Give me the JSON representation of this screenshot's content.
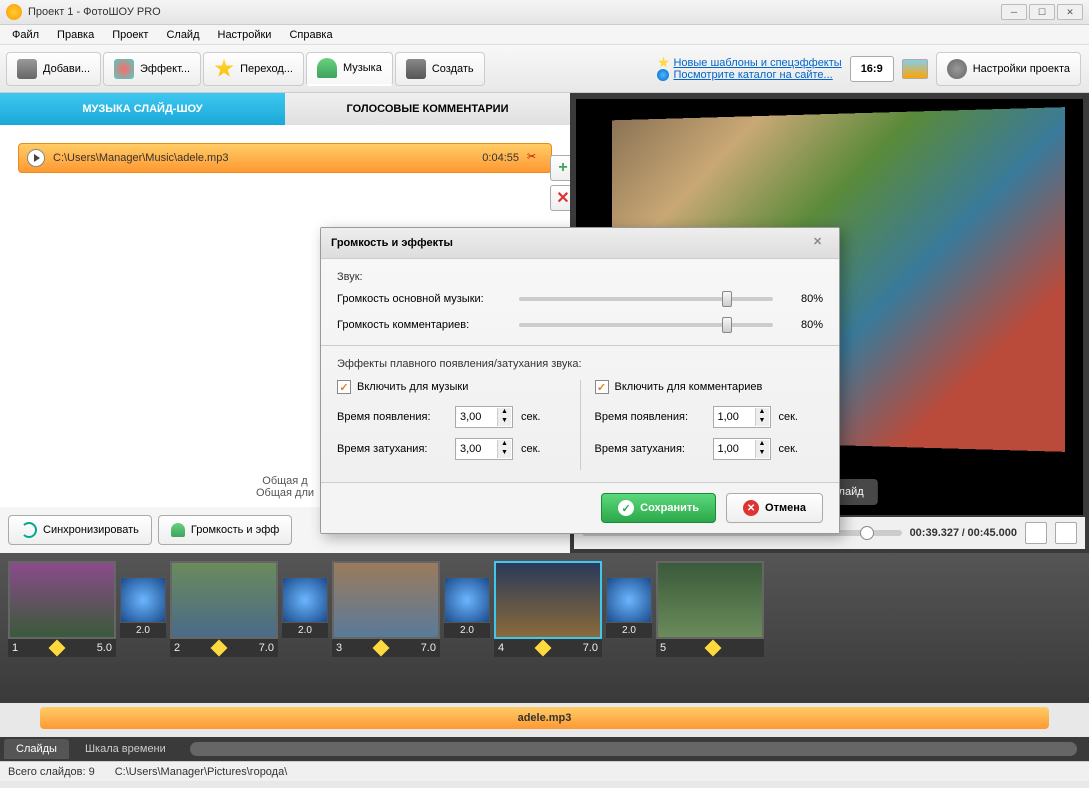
{
  "window": {
    "title": "Проект 1 - ФотоШОУ PRO"
  },
  "menu": {
    "file": "Файл",
    "edit": "Правка",
    "project": "Проект",
    "slide": "Слайд",
    "settings": "Настройки",
    "help": "Справка"
  },
  "toolbar": {
    "add": "Добави...",
    "effects": "Эффект...",
    "transitions": "Переход...",
    "music": "Музыка",
    "create": "Создать",
    "promo1": "Новые шаблоны и спецэффекты",
    "promo2": "Посмотрите каталог на сайте...",
    "aspect": "16:9",
    "project_settings": "Настройки проекта"
  },
  "tabs": {
    "music": "МУЗЫКА СЛАЙД-ШОУ",
    "voice": "ГОЛОСОВЫЕ КОММЕНТАРИИ"
  },
  "music": {
    "path": "C:\\Users\\Manager\\Music\\adele.mp3",
    "duration": "0:04:55"
  },
  "summary": {
    "line1": "Общая д",
    "line2": "Общая дли"
  },
  "buttons": {
    "sync": "Синхронизировать",
    "volume": "Громкость и эфф"
  },
  "preview": {
    "play_btn": "ать слайд",
    "time_current": "00:39.327",
    "time_total": "00:45.000"
  },
  "dialog": {
    "title": "Громкость и эффекты",
    "sound_label": "Звук:",
    "vol_music_label": "Громкость основной музыки:",
    "vol_music_val": "80%",
    "vol_comment_label": "Громкость комментариев:",
    "vol_comment_val": "80%",
    "fade_label": "Эффекты плавного появления/затухания звука:",
    "enable_music": "Включить для музыки",
    "enable_comments": "Включить для комментариев",
    "fadein_label": "Время появления:",
    "fadeout_label": "Время затухания:",
    "music_fadein": "3,00",
    "music_fadeout": "3,00",
    "comment_fadein": "1,00",
    "comment_fadeout": "1,00",
    "sec": "сек.",
    "save": "Сохранить",
    "cancel": "Отмена"
  },
  "timeline": {
    "slides": [
      {
        "num": "1",
        "dur": "5.0"
      },
      {
        "num": "2",
        "dur": "7.0"
      },
      {
        "num": "3",
        "dur": "7.0"
      },
      {
        "num": "4",
        "dur": "7.0"
      },
      {
        "num": "5",
        "dur": ""
      }
    ],
    "trans": "2.0",
    "audio_name": "adele.mp3"
  },
  "bottom_tabs": {
    "slides": "Слайды",
    "timescale": "Шкала времени"
  },
  "status": {
    "total": "Всего слайдов: 9",
    "path": "C:\\Users\\Manager\\Pictures\\города\\"
  }
}
